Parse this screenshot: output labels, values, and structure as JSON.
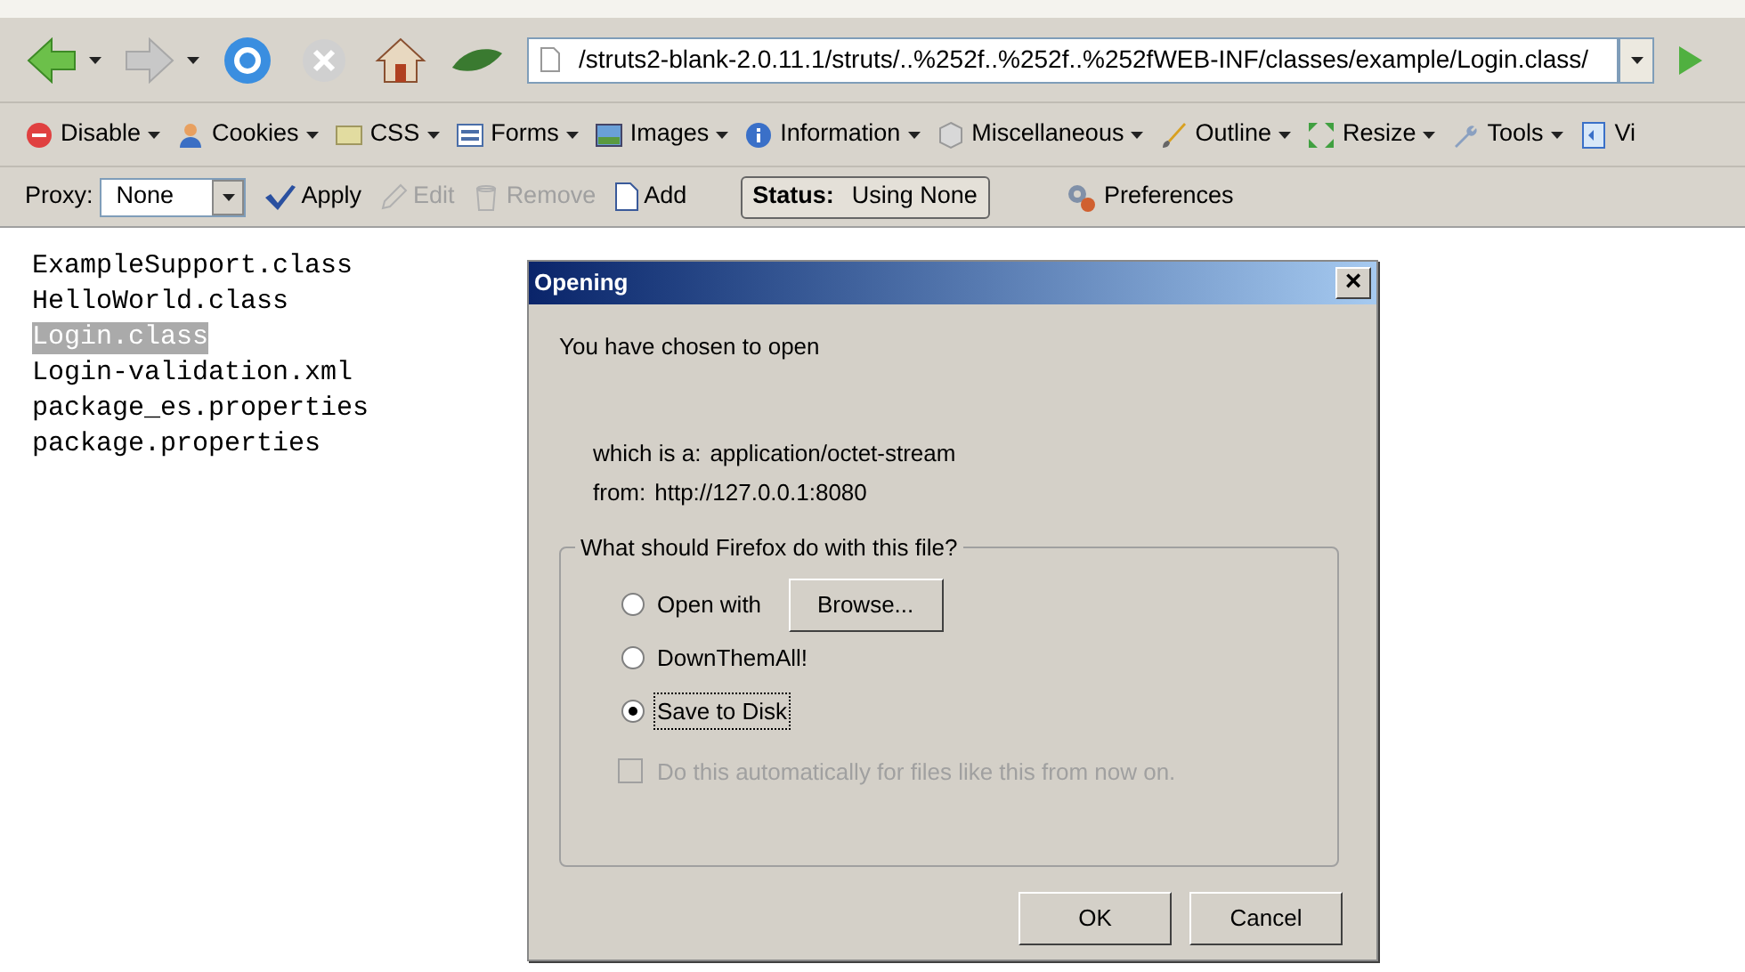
{
  "navigation": {
    "address": "/struts2-blank-2.0.11.1/struts/..%252f..%252f..%252fWEB-INF/classes/example/Login.class/"
  },
  "developer_toolbar": {
    "items": [
      {
        "label": "Disable",
        "kind": "disable"
      },
      {
        "label": "Cookies",
        "kind": "cookies"
      },
      {
        "label": "CSS",
        "kind": "css"
      },
      {
        "label": "Forms",
        "kind": "forms"
      },
      {
        "label": "Images",
        "kind": "images"
      },
      {
        "label": "Information",
        "kind": "information"
      },
      {
        "label": "Miscellaneous",
        "kind": "miscellaneous"
      },
      {
        "label": "Outline",
        "kind": "outline"
      },
      {
        "label": "Resize",
        "kind": "resize"
      },
      {
        "label": "Tools",
        "kind": "tools"
      },
      {
        "label": "Vi",
        "kind": "view"
      }
    ]
  },
  "proxy_toolbar": {
    "label": "Proxy:",
    "proxy_value": "None",
    "actions": [
      {
        "label": "Apply",
        "kind": "apply",
        "disabled": false
      },
      {
        "label": "Edit",
        "kind": "edit",
        "disabled": true
      },
      {
        "label": "Remove",
        "kind": "remove",
        "disabled": true
      },
      {
        "label": "Add",
        "kind": "add",
        "disabled": false
      }
    ],
    "status_label": "Status:",
    "status_value": "Using None",
    "preferences": "Preferences"
  },
  "files": [
    {
      "name": "ExampleSupport.class",
      "selected": false
    },
    {
      "name": "HelloWorld.class",
      "selected": false
    },
    {
      "name": "Login.class",
      "selected": true
    },
    {
      "name": "Login-validation.xml",
      "selected": false
    },
    {
      "name": "package_es.properties",
      "selected": false
    },
    {
      "name": "package.properties",
      "selected": false
    }
  ],
  "dialog": {
    "title": "Opening",
    "close": "×",
    "intro": "You have chosen to open",
    "type_label": "which is a:",
    "type_value": "application/octet-stream",
    "from_label": "from:",
    "from_value": "http://127.0.0.1:8080",
    "group_title": "What should Firefox do with this file?",
    "options": [
      {
        "label": "Open with",
        "selected": false,
        "button": "Browse..."
      },
      {
        "label": "DownThemAll!",
        "selected": false
      },
      {
        "label": "Save to Disk",
        "selected": true
      }
    ],
    "auto": {
      "label": "Do this automatically for files like this from now on.",
      "checked": false,
      "disabled": true
    },
    "buttons": [
      "OK",
      "Cancel"
    ]
  }
}
